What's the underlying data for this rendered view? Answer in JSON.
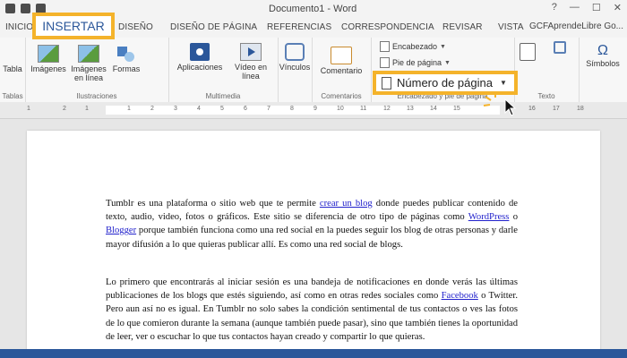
{
  "window": {
    "title": "Documento1 - Word",
    "user": "GCFAprendeLibre Go..."
  },
  "tabs": [
    {
      "label": "INICIO"
    },
    {
      "label": "INSERTAR"
    },
    {
      "label": "DISEÑO"
    },
    {
      "label": "DISEÑO DE PÁGINA"
    },
    {
      "label": "REFERENCIAS"
    },
    {
      "label": "CORRESPONDENCIA"
    },
    {
      "label": "REVISAR"
    },
    {
      "label": "VISTA"
    }
  ],
  "ribbon": {
    "tabla": "Tabla",
    "tablas_group": "Tablas",
    "imagenes": "Imágenes",
    "imagenes_linea": "Imágenes en línea",
    "formas": "Formas",
    "ilustraciones_group": "Ilustraciones",
    "aplicaciones": "Aplicaciones",
    "video": "Vídeo en línea",
    "multimedia_group": "Multimedia",
    "vinculos": "Vínculos",
    "comentario": "Comentario",
    "comentarios_group": "Comentarios",
    "encabezado": "Encabezado",
    "pie_pagina": "Pie de página",
    "numero_pagina": "Número de página",
    "encabezado_group": "Encabezado y pie de página",
    "texto_group": "Texto",
    "simbolos": "Símbolos"
  },
  "document": {
    "p1_a": "Tumblr es una plataforma o sitio web que te permite ",
    "p1_link1": "crear un blog",
    "p1_b": " donde puedes publicar contenido de texto, audio, video, fotos o gráficos. Este sitio se diferencia de otro tipo de páginas como ",
    "p1_link2": "WordPress",
    "p1_c": " o ",
    "p1_link3": "Blogger",
    "p1_d": " porque también funciona como una red social en la puedes seguir los blog de otras personas y darle mayor difusión a lo que quieras publicar allí. Es como una red social de blogs.",
    "p2_a": "Lo primero que encontrarás al iniciar sesión es una bandeja de notificaciones en donde verás las últimas publicaciones de los blogs que estés siguiendo, así como en otras redes sociales como ",
    "p2_link1": "Facebook",
    "p2_b": " o Twitter. Pero aun así no es igual. En Tumblr no solo sabes la condición sentimental de tus contactos o ves las fotos de lo que comieron durante la semana (aunque también puede pasar), sino que también tienes la oportunidad de leer, ver o escuchar lo que tus contactos hayan creado y compartir lo que quieras."
  },
  "ruler": [
    "1",
    "2",
    "1",
    "1",
    "2",
    "3",
    "4",
    "5",
    "6",
    "7",
    "8",
    "9",
    "10",
    "11",
    "12",
    "13",
    "14",
    "15",
    "16",
    "17",
    "18"
  ],
  "colors": {
    "accent": "#2b579a",
    "highlight": "#f4b32b"
  }
}
